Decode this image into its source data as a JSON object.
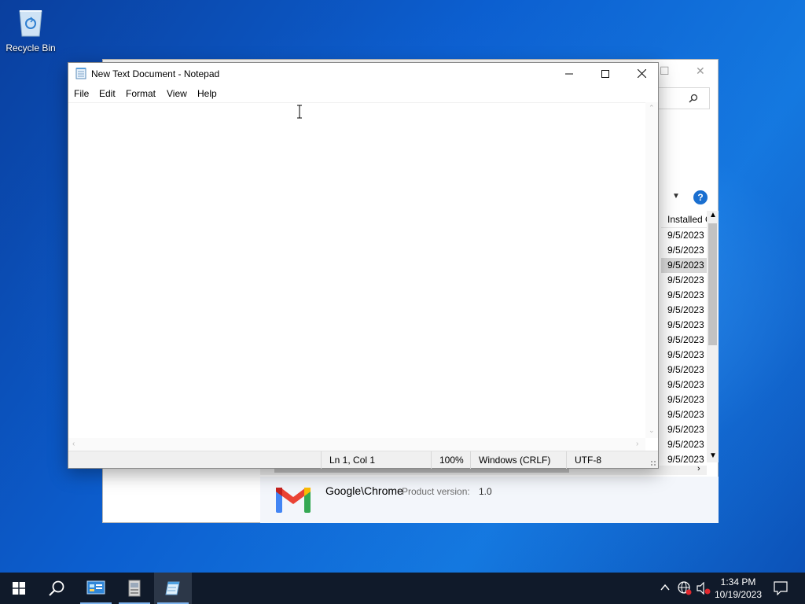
{
  "desktop": {
    "icons": [
      {
        "label": "Recycle Bin",
        "icon": "recycle-bin-icon"
      }
    ]
  },
  "background_window": {
    "column_header": "Installed On",
    "dates": [
      "9/5/2023",
      "9/5/2023",
      "9/5/2023",
      "9/5/2023",
      "9/5/2023",
      "9/5/2023",
      "9/5/2023",
      "9/5/2023",
      "9/5/2023",
      "9/5/2023",
      "9/5/2023",
      "9/5/2023",
      "9/5/2023",
      "9/5/2023",
      "9/5/2023",
      "9/5/2023"
    ],
    "selected_row_index": 2,
    "details": {
      "name": "Google\\Chrome",
      "product_version_label": "Product version:",
      "product_version_value": "1.0",
      "icon": "gmail-icon"
    },
    "help_label": "?"
  },
  "notepad": {
    "title": "New Text Document - Notepad",
    "menu": [
      "File",
      "Edit",
      "Format",
      "View",
      "Help"
    ],
    "content": "",
    "status": {
      "position": "Ln 1, Col 1",
      "zoom": "100%",
      "line_endings": "Windows (CRLF)",
      "encoding": "UTF-8"
    }
  },
  "taskbar": {
    "clock_time": "1:34 PM",
    "clock_date": "10/19/2023",
    "accent": "#7fb4ee"
  }
}
